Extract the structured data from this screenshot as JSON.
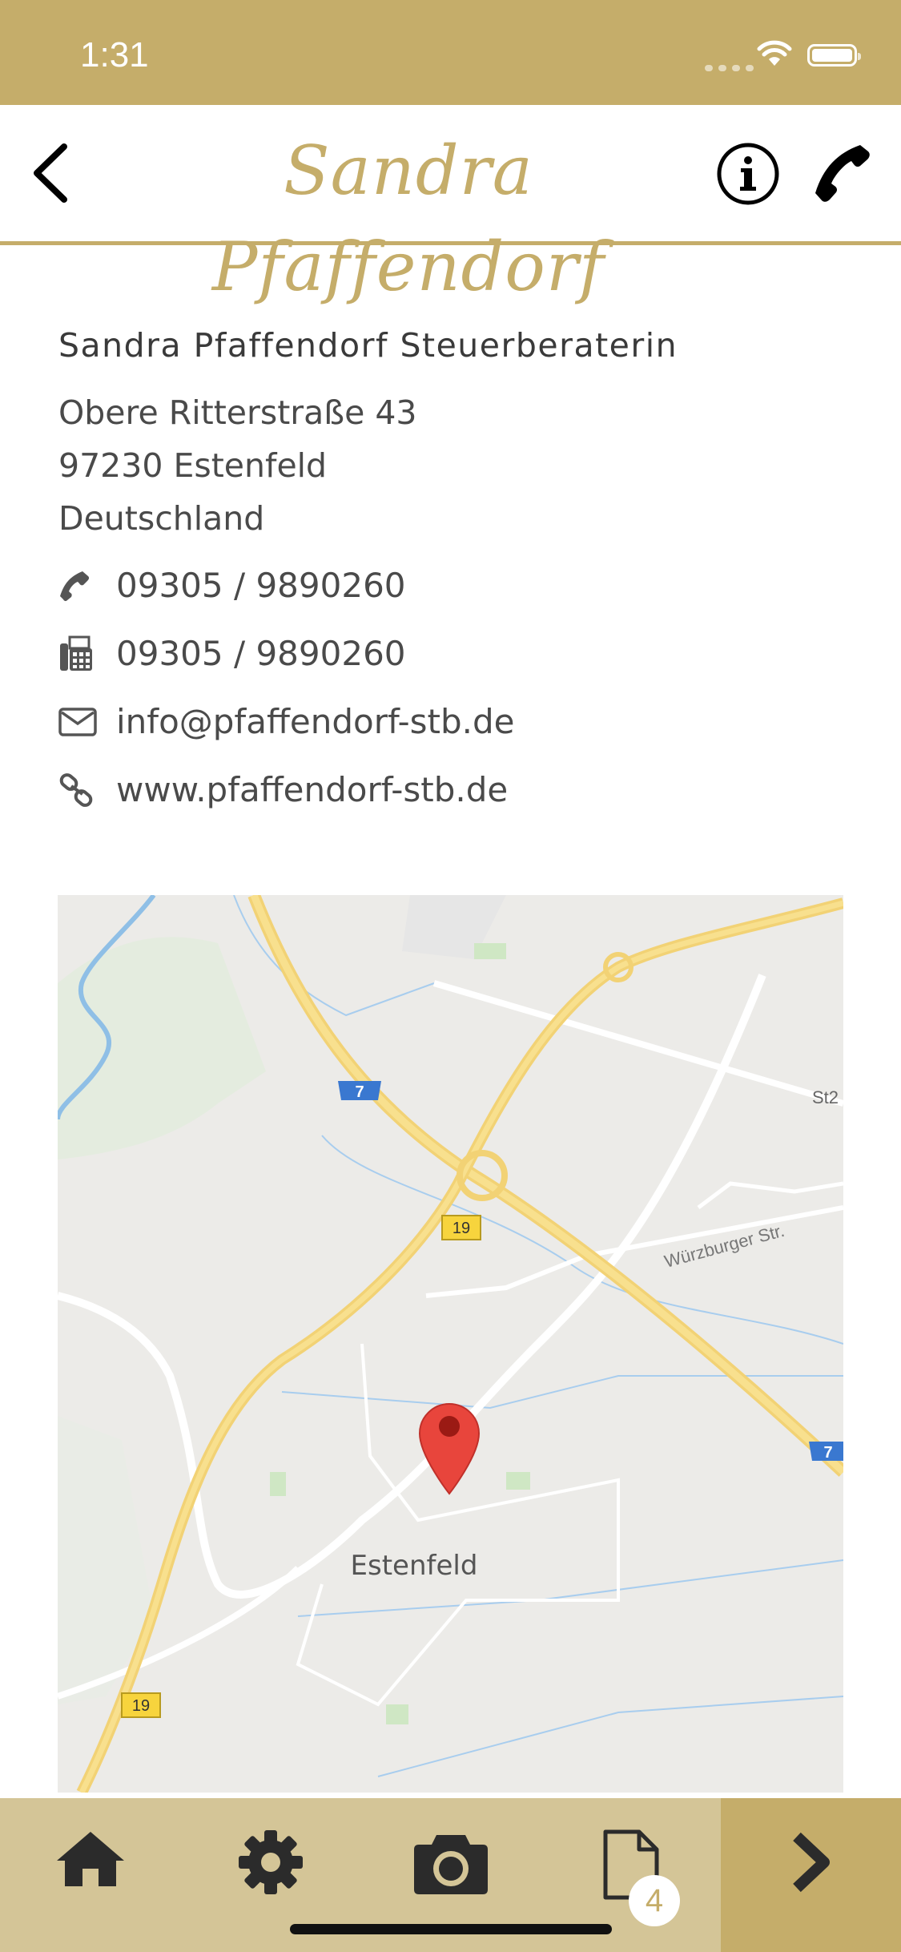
{
  "status_bar": {
    "time": "1:31"
  },
  "header": {
    "brand": "Sandra Pfaffendorf"
  },
  "contact": {
    "company": "Sandra Pfaffendorf Steuerberaterin",
    "street": "Obere Ritterstraße 43",
    "city": "97230 Estenfeld",
    "country": "Deutschland",
    "phone": "09305 / 9890260",
    "fax": "09305 / 9890260",
    "email": "info@pfaffendorf-stb.de",
    "website": "www.pfaffendorf-stb.de"
  },
  "map": {
    "town_label": "Estenfeld",
    "street_label": "Würzburger Str.",
    "road_label_st": "St2",
    "highway_7": "7",
    "road_19": "19"
  },
  "tabbar": {
    "documents_badge": "4"
  },
  "colors": {
    "brand": "#c5ad6a",
    "tabbar": "#d4c597",
    "pin": "#e8453c"
  }
}
